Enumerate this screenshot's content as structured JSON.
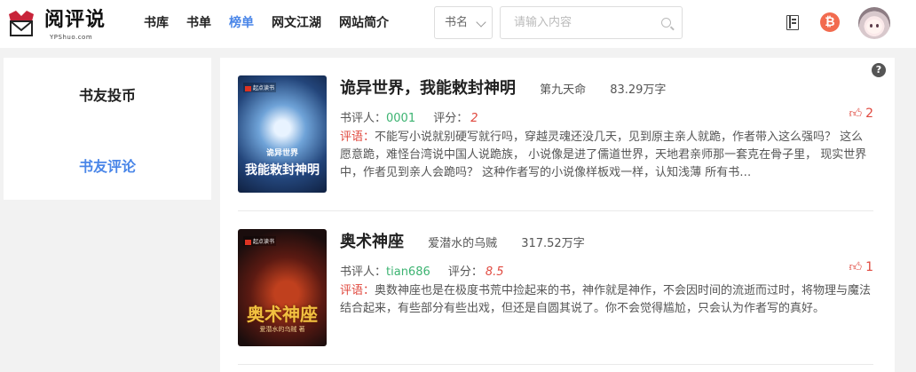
{
  "logo": {
    "text": "阅评说",
    "sub": "YPShuo.com"
  },
  "nav": {
    "items": [
      "书库",
      "书单",
      "榜单",
      "网文江湖",
      "网站简介"
    ],
    "active_index": 2
  },
  "search": {
    "select_value": "书名",
    "placeholder": "请输入内容"
  },
  "header_icons": {
    "coin": "₿"
  },
  "sidebar": {
    "items": [
      "书友投币",
      "书友评论"
    ]
  },
  "help": "?",
  "labels": {
    "reviewer": "书评人：",
    "score": "评分：",
    "review": "评语："
  },
  "books": [
    {
      "title": "诡异世界，我能敕封神明",
      "author": "第九天命",
      "words": "83.29万字",
      "cover_pub": "起点读书",
      "cover_sub": "诡异世界",
      "cover_title": "我能敕封神明",
      "reviewer": "0001",
      "score": "2",
      "likes": "2",
      "review": "不能写小说就别硬写就行吗，穿越灵魂还没几天，见到原主亲人就跪，作者带入这么强吗？ 这么愿意跪，难怪台湾说中国人说跪族， 小说像是进了儒道世界，天地君亲师那一套克在骨子里， 现实世界中，作者见到亲人会跪吗？ 这种作者写的小说像样板戏一样，认知浅薄 所有书…"
    },
    {
      "title": "奥术神座",
      "author": "爱潜水的乌贼",
      "words": "317.52万字",
      "cover_pub": "起点读书",
      "cover_sub": "爱潜水的乌贼 著",
      "cover_title": "奥术神座",
      "reviewer": "tian686",
      "score": "8.5",
      "likes": "1",
      "review": "奥数神座也是在极度书荒中捡起来的书，神作就是神作，不会因时间的流逝而过时，将物理与魔法结合起来，有些部分有些出戏，但还是自圆其说了。你不会觉得尴尬，只会认为作者写的真好。"
    }
  ]
}
